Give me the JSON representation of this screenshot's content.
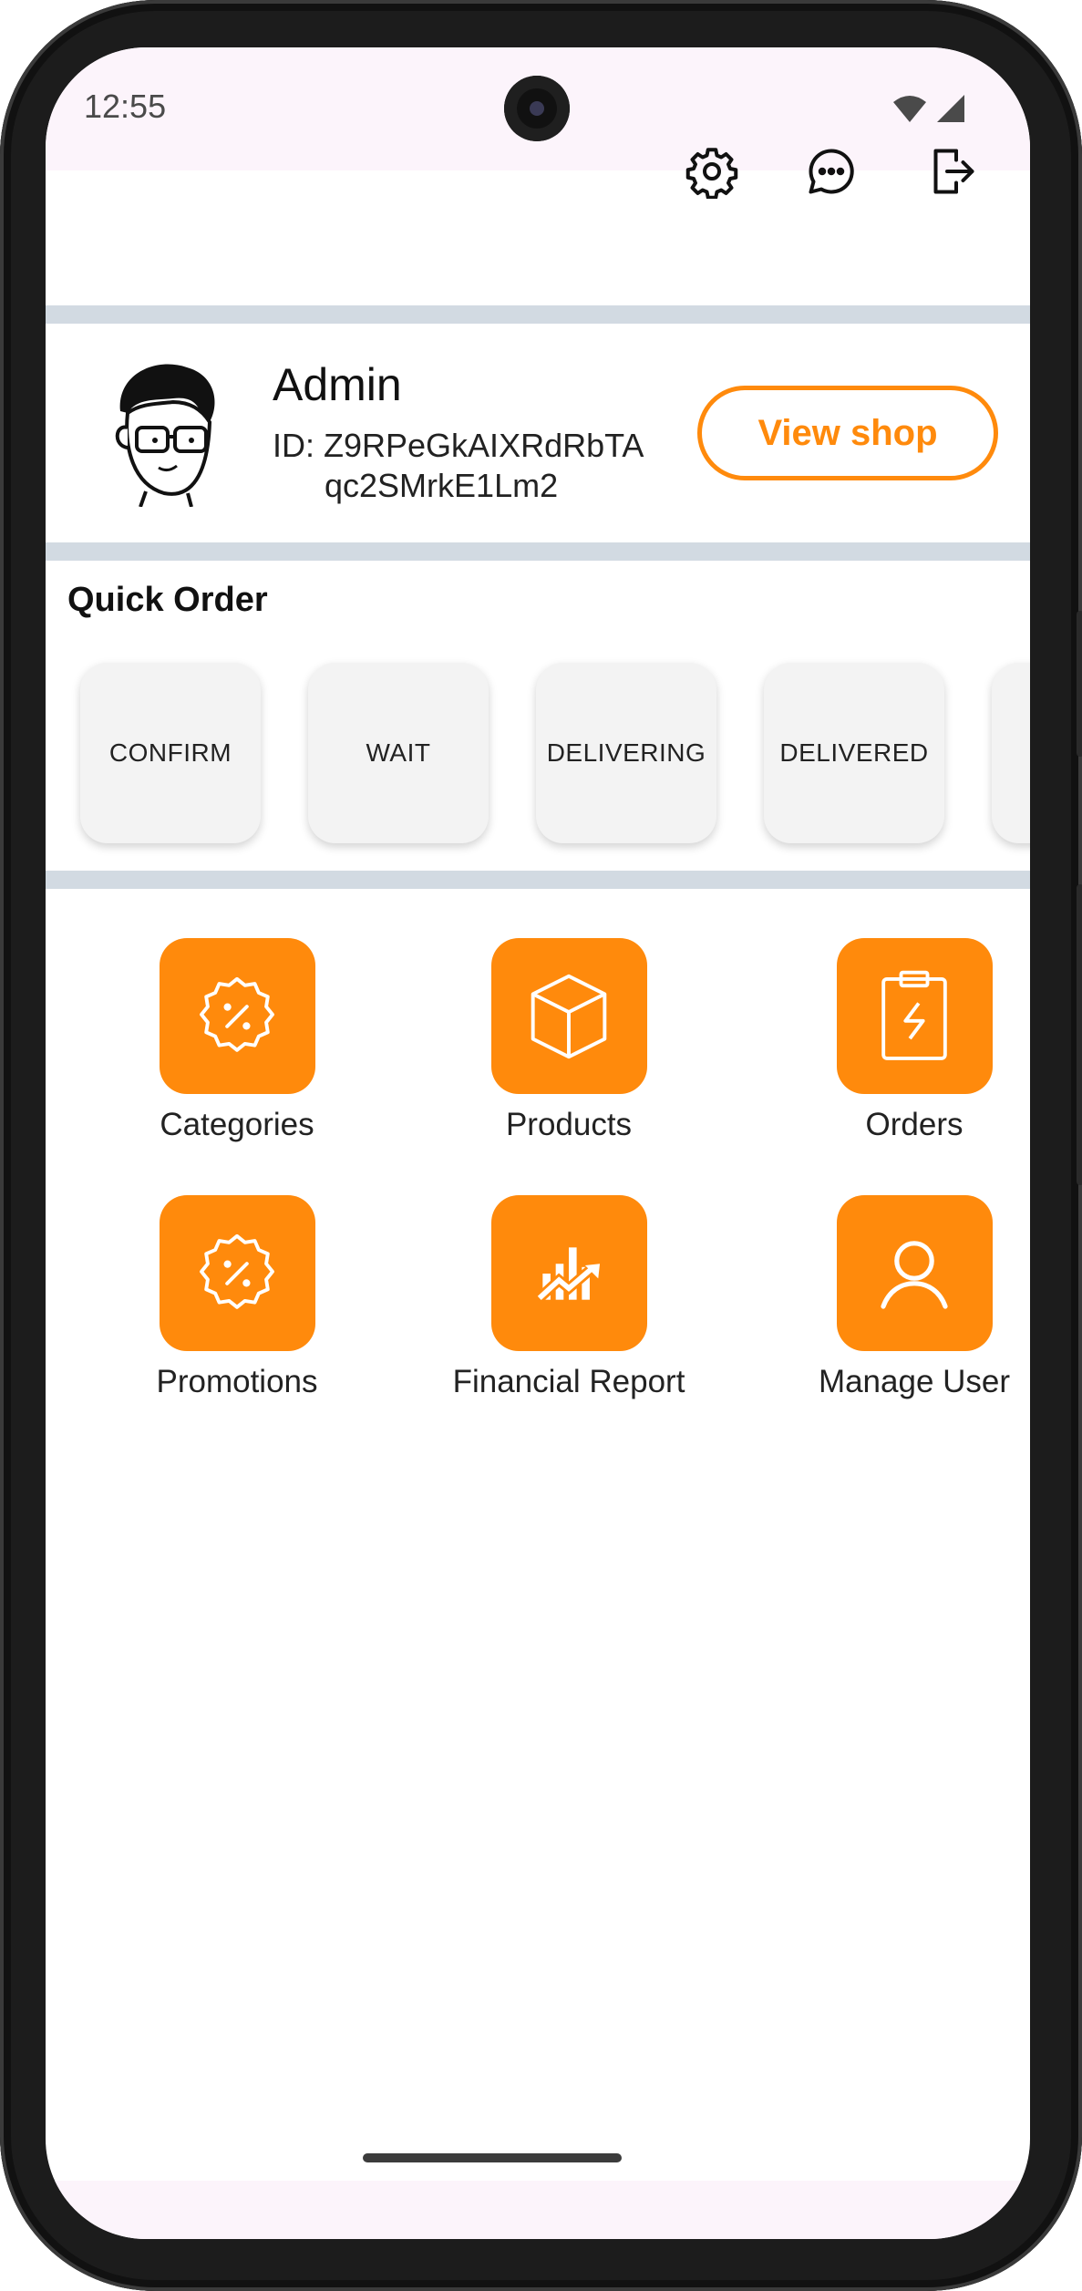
{
  "status_bar": {
    "time": "12:55",
    "icons": [
      "wifi-icon",
      "signal-icon"
    ]
  },
  "top_actions": [
    "gear-icon",
    "chat-icon",
    "logout-icon"
  ],
  "profile": {
    "name": "Admin",
    "id_line1": "ID: Z9RPeGkAIXRdRbTA",
    "id_line2": "qc2SMrkE1Lm2",
    "view_shop_label": "View shop"
  },
  "quick_order": {
    "title": "Quick Order",
    "items": [
      "CONFIRM",
      "WAIT",
      "DELIVERING",
      "DELIVERED",
      ""
    ]
  },
  "menu": [
    {
      "label": "Categories",
      "icon": "badge-percent-icon"
    },
    {
      "label": "Products",
      "icon": "box-icon"
    },
    {
      "label": "Orders",
      "icon": "clipboard-icon"
    },
    {
      "label": "Promotions",
      "icon": "badge-percent-icon"
    },
    {
      "label": "Financial Report",
      "icon": "chart-trend-icon"
    },
    {
      "label": "Manage User",
      "icon": "user-icon"
    }
  ],
  "colors": {
    "accent": "#ff8a0c",
    "divider": "#d2dae2",
    "status_bg": "#fcf4fb"
  }
}
